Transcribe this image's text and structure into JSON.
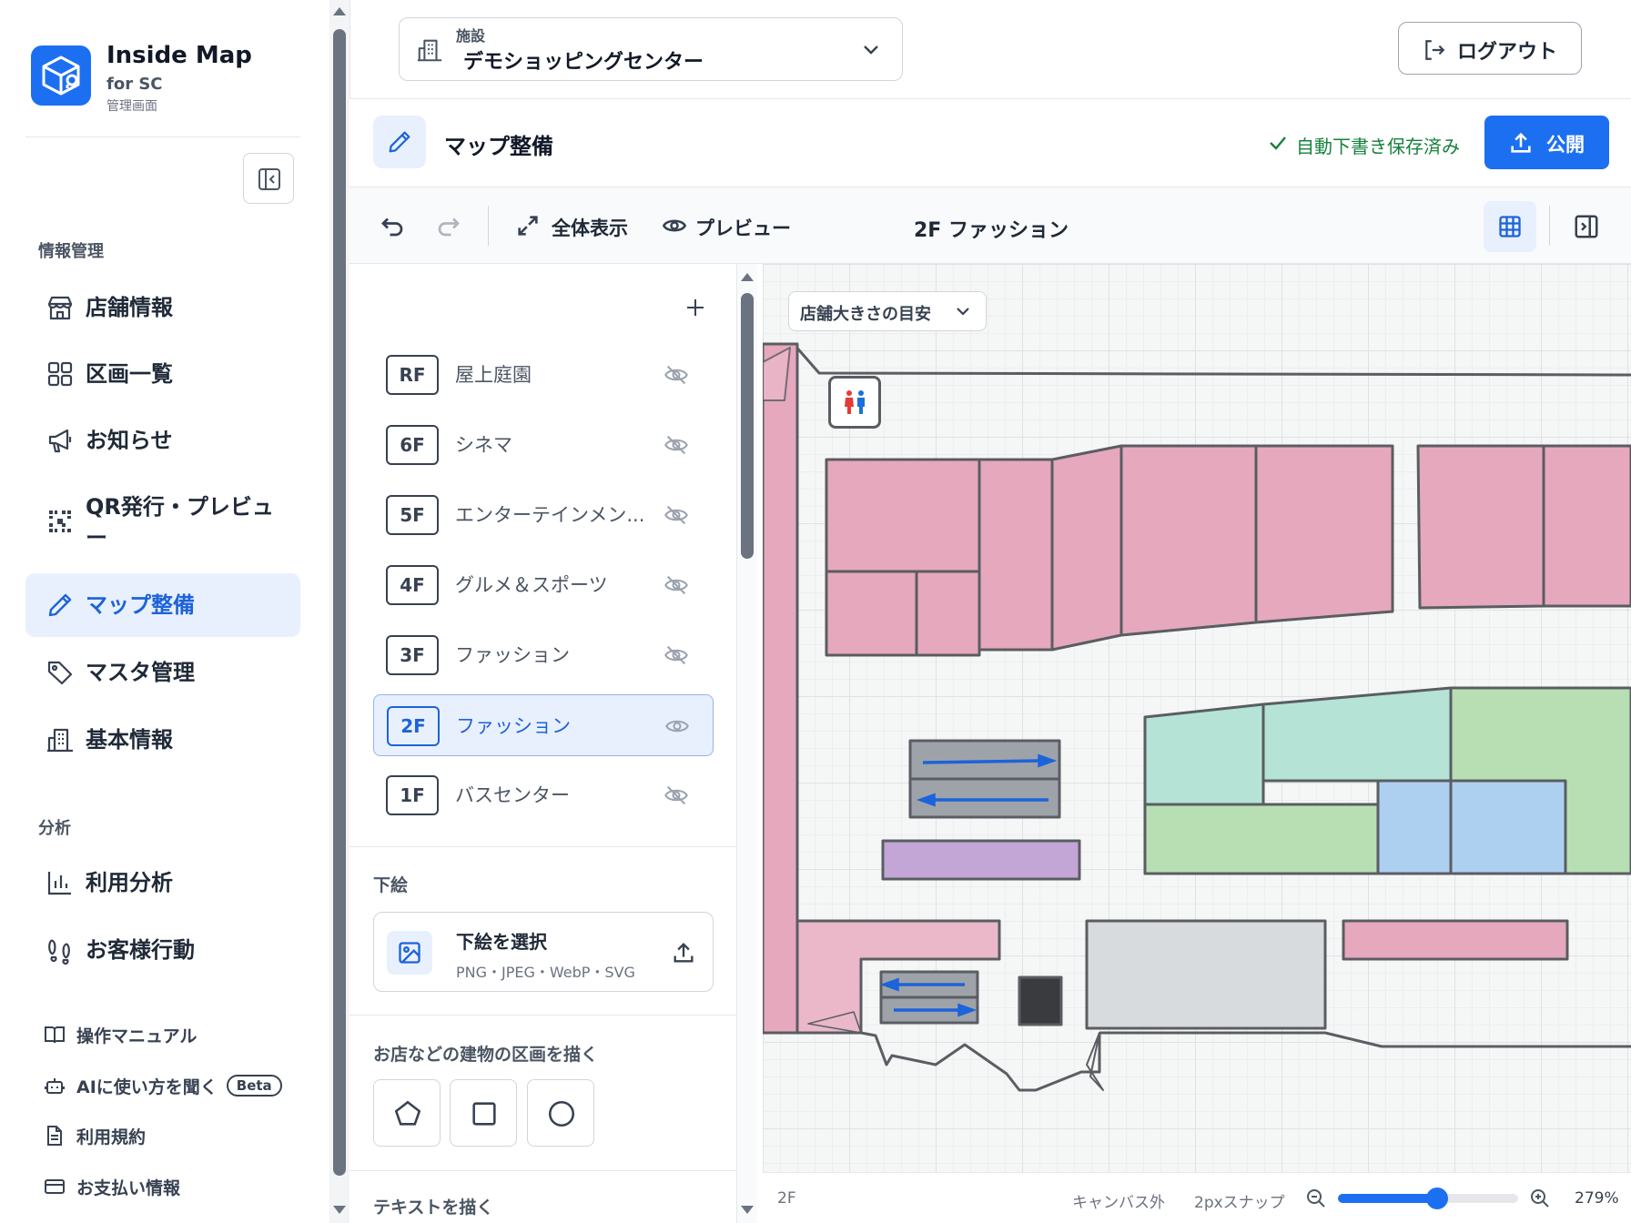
{
  "brand": {
    "title": "Inside Map",
    "subtitle": "for SC",
    "caption": "管理画面"
  },
  "sidebar": {
    "section_info": "情報管理",
    "items": [
      {
        "label": "店舗情報",
        "icon": "store-icon"
      },
      {
        "label": "区画一覧",
        "icon": "grid-icon"
      },
      {
        "label": "お知らせ",
        "icon": "megaphone-icon"
      },
      {
        "label": "QR発行・プレビュー",
        "icon": "qr-code-icon"
      },
      {
        "label": "マップ整備",
        "icon": "pencil-icon",
        "active": true
      },
      {
        "label": "マスタ管理",
        "icon": "tag-icon"
      },
      {
        "label": "基本情報",
        "icon": "building-icon"
      }
    ],
    "section_analysis": "分析",
    "analysis_items": [
      {
        "label": "利用分析",
        "icon": "bar-chart-icon"
      },
      {
        "label": "お客様行動",
        "icon": "footprints-icon"
      }
    ],
    "footer_items": [
      {
        "label": "操作マニュアル",
        "icon": "book-icon"
      },
      {
        "label": "AIに使い方を聞く",
        "icon": "bot-icon",
        "badge": "Beta"
      },
      {
        "label": "利用規約",
        "icon": "document-icon"
      },
      {
        "label": "お支払い情報",
        "icon": "credit-card-icon"
      }
    ]
  },
  "header": {
    "facility_label": "施設",
    "facility_value": "デモショッピングセンター",
    "logout": "ログアウト"
  },
  "page": {
    "title": "マップ整備",
    "autosave": "自動下書き保存済み",
    "publish": "公開"
  },
  "toolbar": {
    "fit": "全体表示",
    "preview": "プレビュー",
    "current_floor": "2F ファッション"
  },
  "floors": [
    {
      "code": "RF",
      "name": "屋上庭園",
      "visible": false
    },
    {
      "code": "6F",
      "name": "シネマ",
      "visible": false
    },
    {
      "code": "5F",
      "name": "エンターテインメン...",
      "visible": false
    },
    {
      "code": "4F",
      "name": "グルメ＆スポーツ",
      "visible": false
    },
    {
      "code": "3F",
      "name": "ファッション",
      "visible": false
    },
    {
      "code": "2F",
      "name": "ファッション",
      "visible": true,
      "active": true
    },
    {
      "code": "1F",
      "name": "バスセンター",
      "visible": false
    }
  ],
  "underlay": {
    "section": "下絵",
    "title": "下絵を選択",
    "formats": "PNG・JPEG・WebP・SVG"
  },
  "draw": {
    "section": "お店などの建物の区画を描く",
    "text_section": "テキストを描く",
    "tools": [
      "polygon-tool",
      "rectangle-tool",
      "circle-tool"
    ]
  },
  "canvas": {
    "size_guide": "店舗大きさの目安"
  },
  "status": {
    "floor": "2F",
    "outside": "キャンバス外",
    "snap": "2pxスナップ",
    "zoom": "279%",
    "zoom_fraction": 0.55
  },
  "colors": {
    "accent": "#1d6ff2",
    "success": "#16803c",
    "shop_pink": "#e6a8bc",
    "teal": "#b5e3d6",
    "green": "#b8dfb4",
    "blue": "#aed0f0",
    "purple": "#c3a6d6",
    "gray": "#d8dbde"
  }
}
